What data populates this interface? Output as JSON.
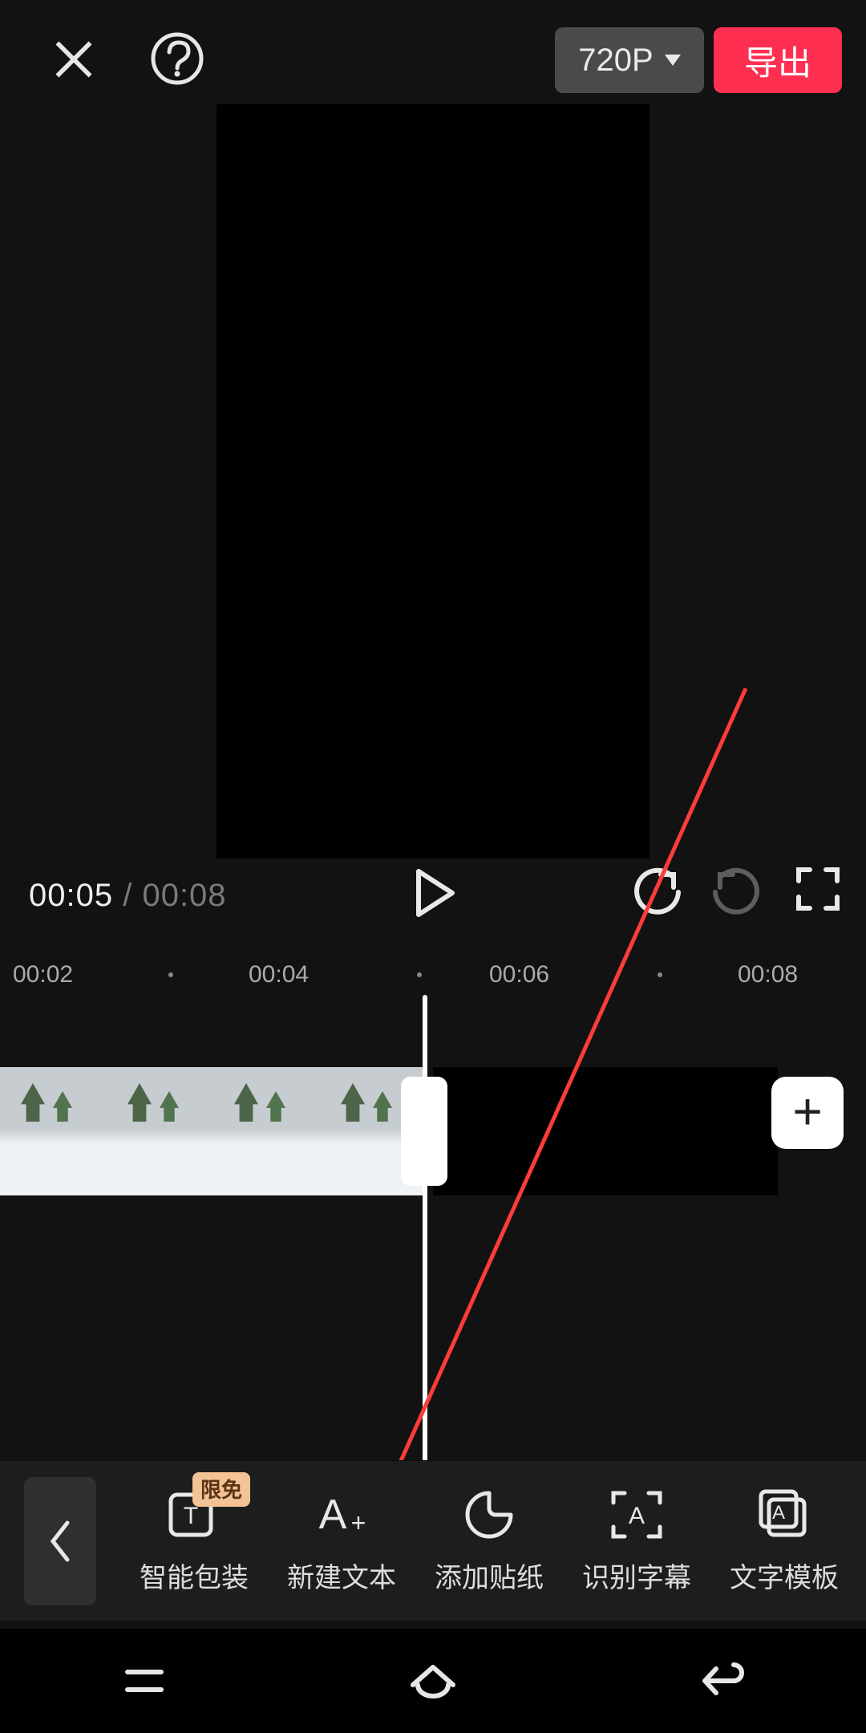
{
  "topbar": {
    "resolution_label": "720P",
    "export_label": "导出"
  },
  "playback": {
    "current": "00:05",
    "separator": " / ",
    "duration": "00:08"
  },
  "ruler": {
    "ticks": [
      "00:02",
      "00:04",
      "00:06",
      "00:08"
    ]
  },
  "toolbar": {
    "items": [
      {
        "label": "智能包装",
        "badge": "限免"
      },
      {
        "label": "新建文本"
      },
      {
        "label": "添加贴纸"
      },
      {
        "label": "识别字幕"
      },
      {
        "label": "文字模板"
      }
    ]
  },
  "colors": {
    "accent": "#ff2f52"
  }
}
